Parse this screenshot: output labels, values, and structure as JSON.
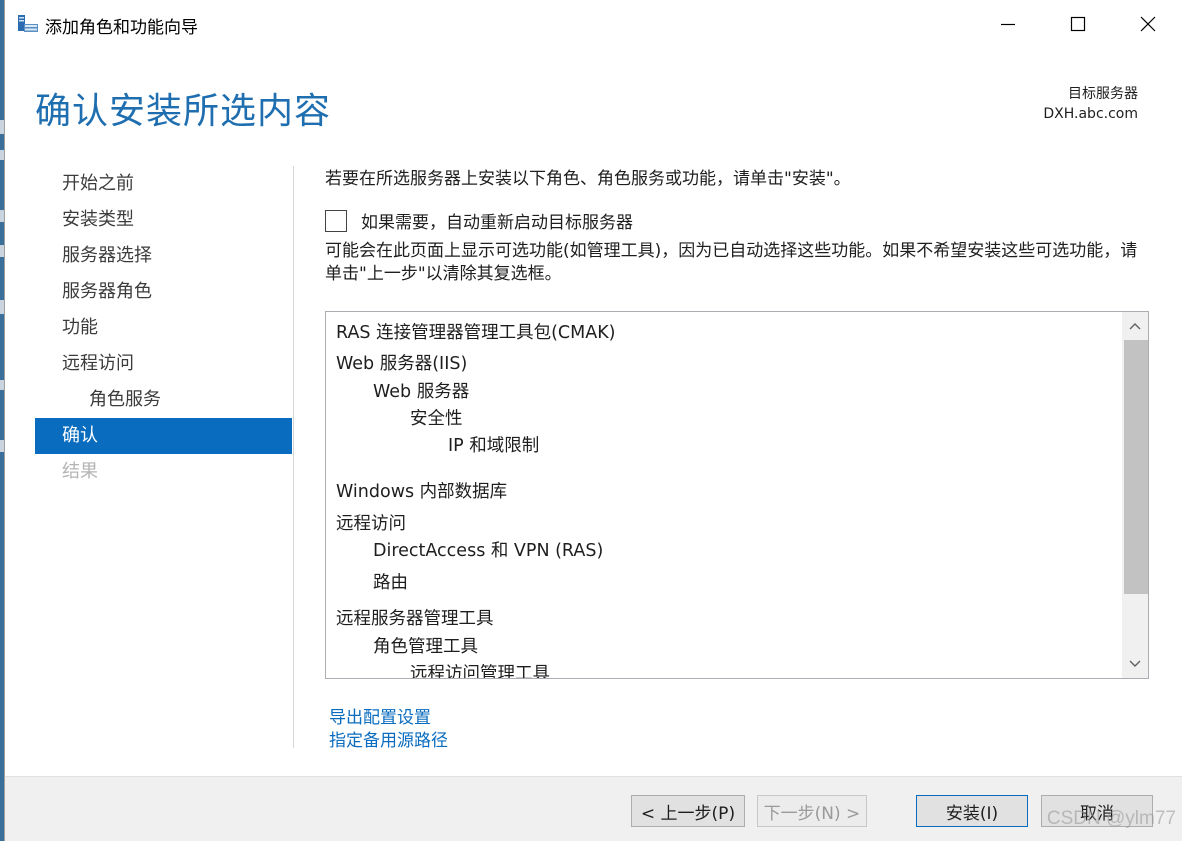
{
  "window": {
    "title": "添加角色和功能向导"
  },
  "header": {
    "page_title": "确认安装所选内容",
    "target_label": "目标服务器",
    "target_value": "DXH.abc.com"
  },
  "nav": {
    "items": [
      {
        "label": "开始之前",
        "state": "normal"
      },
      {
        "label": "安装类型",
        "state": "normal"
      },
      {
        "label": "服务器选择",
        "state": "normal"
      },
      {
        "label": "服务器角色",
        "state": "normal"
      },
      {
        "label": "功能",
        "state": "normal"
      },
      {
        "label": "远程访问",
        "state": "normal"
      },
      {
        "label": "角色服务",
        "state": "sub"
      },
      {
        "label": "确认",
        "state": "active"
      },
      {
        "label": "结果",
        "state": "disabled"
      }
    ]
  },
  "main": {
    "instruction": "若要在所选服务器上安装以下角色、角色服务或功能，请单击\"安装\"。",
    "restart_checkbox": {
      "label": "如果需要，自动重新启动目标服务器",
      "checked": false
    },
    "note": "可能会在此页面上显示可选功能(如管理工具)，因为已自动选择这些功能。如果不希望安装这些可选功能，请单击\"上一步\"以清除其复选框。",
    "features": [
      {
        "text": "RAS 连接管理器管理工具包(CMAK)",
        "level": 0
      },
      {
        "text": "Web 服务器(IIS)",
        "level": 0
      },
      {
        "text": "Web 服务器",
        "level": 1
      },
      {
        "text": "安全性",
        "level": 2
      },
      {
        "text": "IP 和域限制",
        "level": 3
      },
      {
        "text": "Windows 内部数据库",
        "level": 0
      },
      {
        "text": "远程访问",
        "level": 0
      },
      {
        "text": "DirectAccess 和 VPN (RAS)",
        "level": 1
      },
      {
        "text": "路由",
        "level": 1
      },
      {
        "text": "远程服务器管理工具",
        "level": 0
      },
      {
        "text": "角色管理工具",
        "level": 1
      },
      {
        "text": "远程访问管理工具",
        "level": 2
      }
    ],
    "links": {
      "export": "导出配置设置",
      "alternate_source": "指定备用源路径"
    }
  },
  "footer": {
    "back": "< 上一步(P)",
    "next": "下一步(N) >",
    "install": "安装(I)",
    "cancel": "取消"
  },
  "watermark": "CSDN @ylm77",
  "colors": {
    "accent": "#0a6cbf",
    "title_blue": "#1f6fb0",
    "footer_bg": "#f0f0f0"
  }
}
